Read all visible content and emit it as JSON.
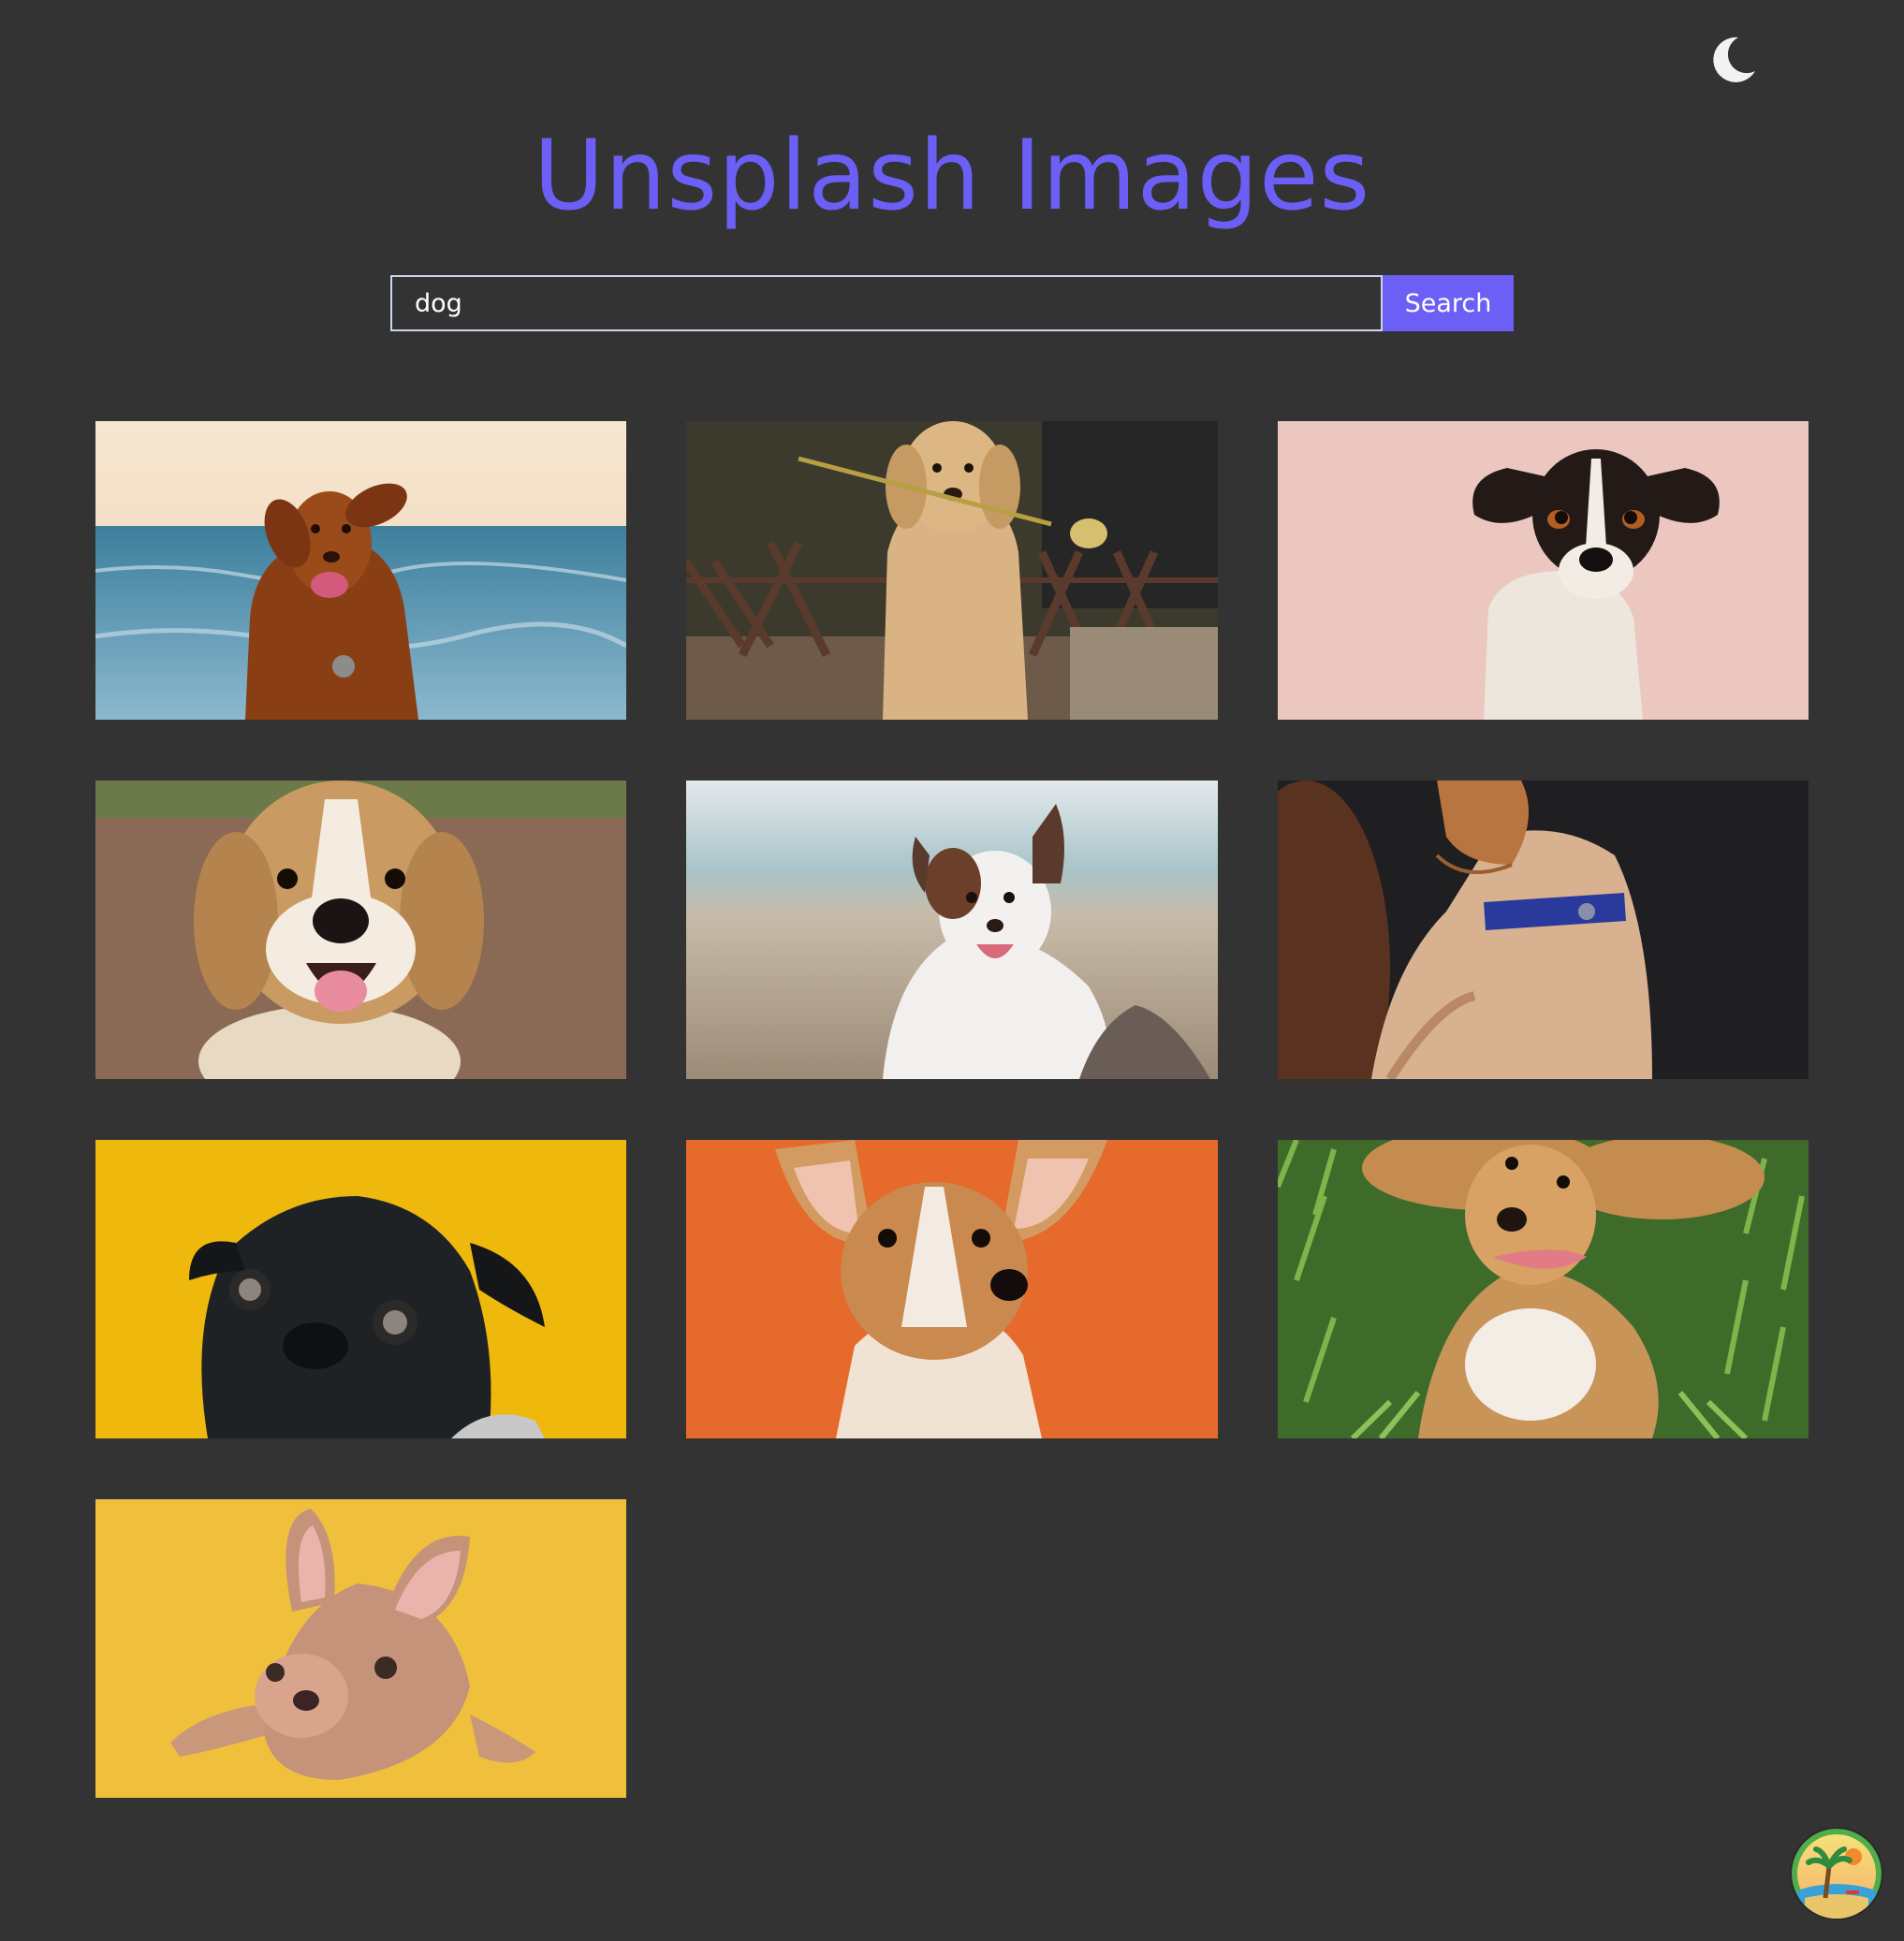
{
  "header": {
    "title": "Unsplash Images",
    "theme_toggle_icon": "moon-icon"
  },
  "search": {
    "value": "dog",
    "button_label": "Search"
  },
  "colors": {
    "background": "#333333",
    "accent": "#6c5ff6",
    "input_border": "#c9d6ec",
    "text": "#ffffff"
  },
  "results": [
    {
      "subject": "dog",
      "background": "#5b8fa8"
    },
    {
      "subject": "dog",
      "background": "#6b5a4c"
    },
    {
      "subject": "dog",
      "background": "#ecc6bf"
    },
    {
      "subject": "dog",
      "background": "#8b6a52"
    },
    {
      "subject": "dog",
      "background": "#b9c2c1"
    },
    {
      "subject": "dog",
      "background": "#1f1f22"
    },
    {
      "subject": "dog",
      "background": "#eeb80c"
    },
    {
      "subject": "dog",
      "background": "#e56a2c"
    },
    {
      "subject": "dog",
      "background": "#4f7a35"
    },
    {
      "subject": "dog",
      "background": "#f0c03c"
    }
  ],
  "floating_button": {
    "icon": "palm-tree-icon"
  }
}
